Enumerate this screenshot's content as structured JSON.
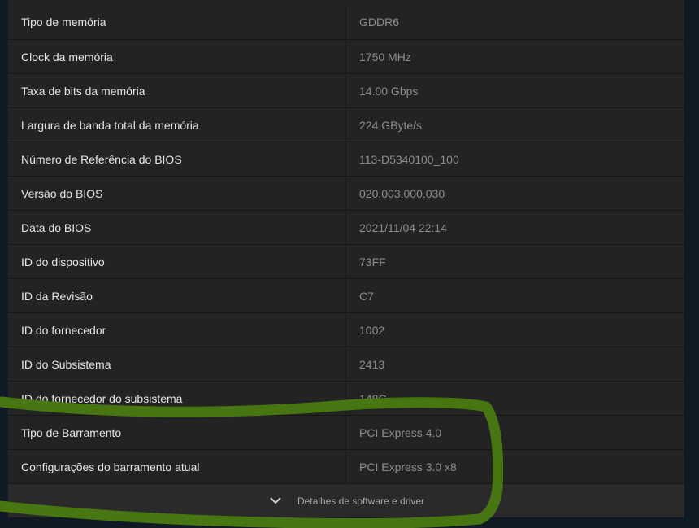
{
  "rows": [
    {
      "label": "Tipo de memória",
      "value": "GDDR6"
    },
    {
      "label": "Clock da memória",
      "value": "1750 MHz"
    },
    {
      "label": "Taxa de bits da memória",
      "value": "14.00 Gbps"
    },
    {
      "label": "Largura de banda total da memória",
      "value": "224 GByte/s"
    },
    {
      "label": "Número de Referência do BIOS",
      "value": "113-D5340100_100"
    },
    {
      "label": "Versão do BIOS",
      "value": "020.003.000.030"
    },
    {
      "label": "Data do BIOS",
      "value": "2021/11/04 22:14"
    },
    {
      "label": "ID do dispositivo",
      "value": "73FF"
    },
    {
      "label": "ID da Revisão",
      "value": "C7"
    },
    {
      "label": "ID do fornecedor",
      "value": "1002"
    },
    {
      "label": "ID do Subsistema",
      "value": "2413"
    },
    {
      "label": "ID do fornecedor do subsistema",
      "value": "148C"
    },
    {
      "label": "Tipo de Barramento",
      "value": "PCI Express 4.0"
    },
    {
      "label": "Configurações do barramento atual",
      "value": "PCI Express 3.0 x8"
    }
  ],
  "footer": {
    "label": "Detalhes de software e driver",
    "icon": "chevron-down-icon"
  },
  "colors": {
    "background": "#0f1a24",
    "panel": "#232323",
    "label_text": "#e6e6e6",
    "value_text": "#8d8d8d",
    "highlight": "#4a7a12"
  }
}
